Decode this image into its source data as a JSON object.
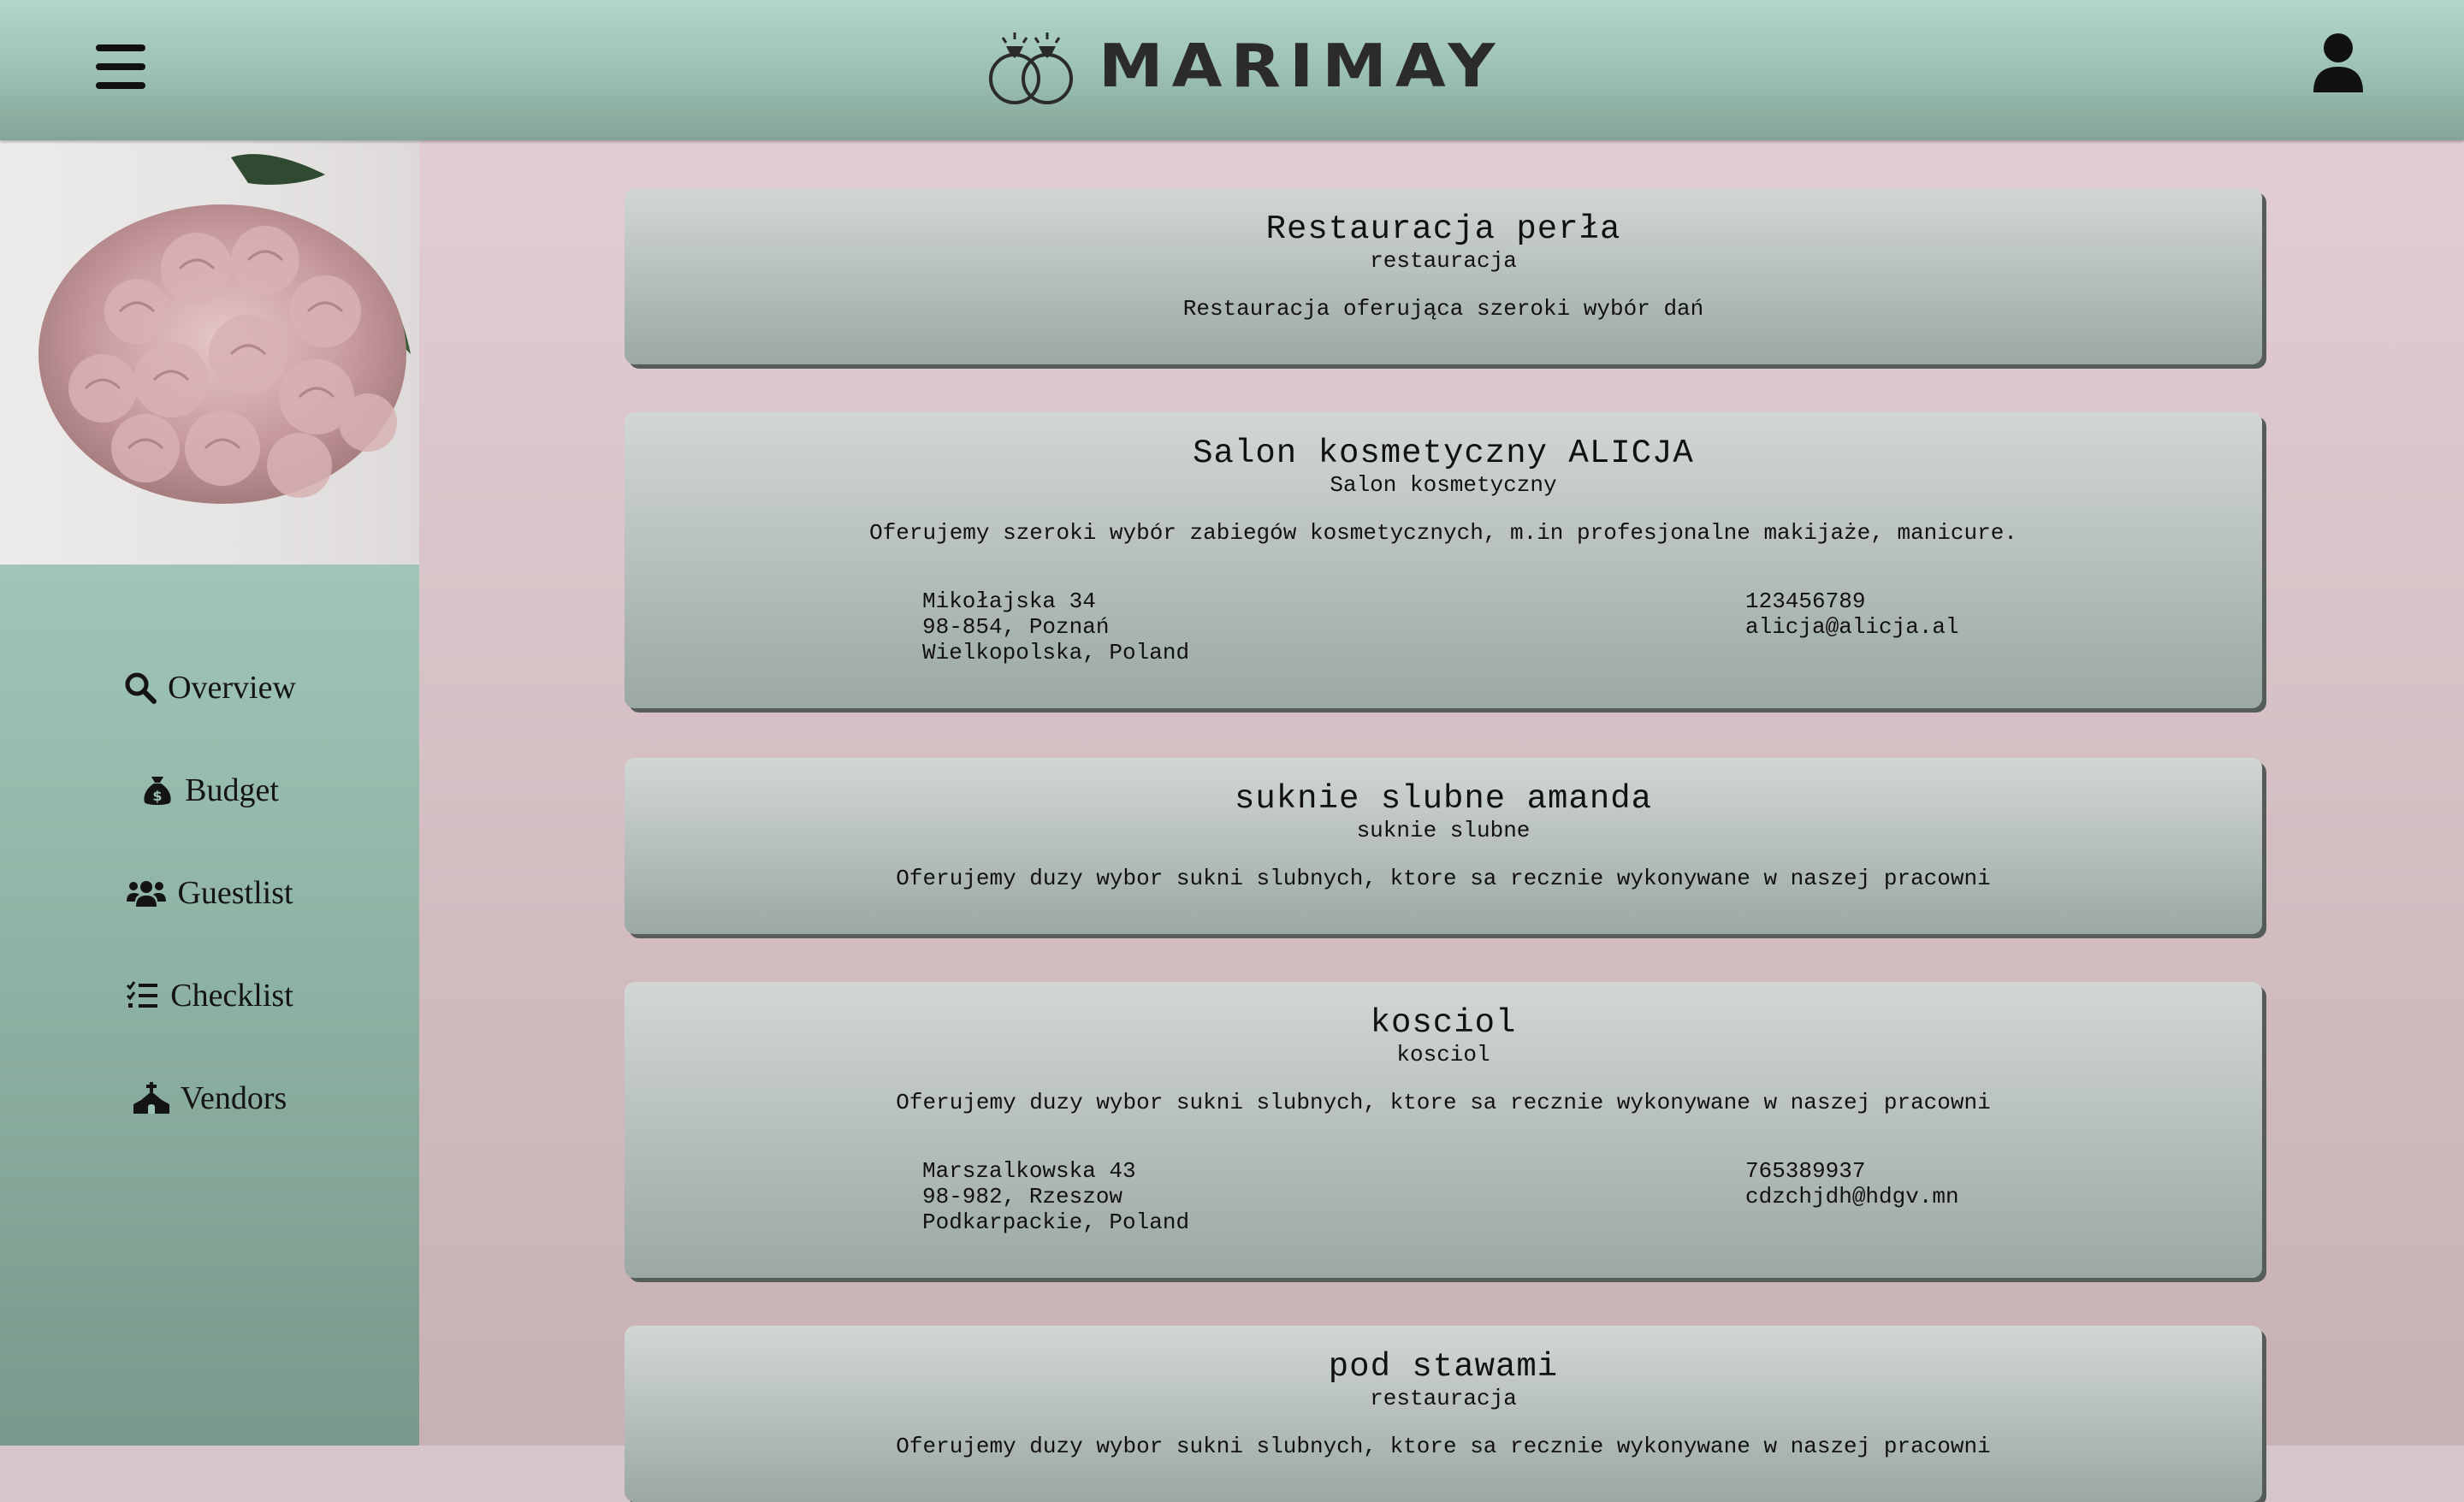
{
  "header": {
    "brand": "MARIMAY",
    "icons": {
      "menu": "hamburger-menu-icon",
      "logo": "wedding-rings-icon",
      "user": "user-icon"
    }
  },
  "sidebar": {
    "photo": "pink hydrangea bouquet",
    "nav": [
      {
        "label": "Overview",
        "icon": "search-icon"
      },
      {
        "label": "Budget",
        "icon": "money-bag-icon"
      },
      {
        "label": "Guestlist",
        "icon": "users-icon"
      },
      {
        "label": "Checklist",
        "icon": "checklist-icon"
      },
      {
        "label": "Vendors",
        "icon": "church-icon"
      }
    ]
  },
  "vendors": [
    {
      "name": "Restauracja perła",
      "category": "restauracja",
      "description": "Restauracja oferująca szeroki wybór dań"
    },
    {
      "name": "Salon kosmetyczny ALICJA",
      "category": "Salon kosmetyczny",
      "description": "Oferujemy szeroki wybór zabiegów kosmetycznych, m.in profesjonalne makijaże, manicure.",
      "street": "Mikołajska 34",
      "city": "98-854, Poznań",
      "region": "Wielkopolska, Poland",
      "phone": "123456789",
      "email": "alicja@alicja.al"
    },
    {
      "name": "suknie slubne amanda",
      "category": "suknie slubne",
      "description": "Oferujemy duzy wybor sukni slubnych, ktore sa recznie wykonywane w naszej pracowni"
    },
    {
      "name": "kosciol",
      "category": "kosciol",
      "description": "Oferujemy duzy wybor sukni slubnych, ktore sa recznie wykonywane w naszej pracowni",
      "street": "Marszalkowska 43",
      "city": "98-982, Rzeszow",
      "region": "Podkarpackie, Poland",
      "phone": "765389937",
      "email": "cdzchjdh@hdgv.mn"
    },
    {
      "name": "pod stawami",
      "category": "restauracja",
      "description": "Oferujemy duzy wybor sukni slubnych, ktore sa recznie wykonywane w naszej pracowni"
    }
  ],
  "colors": {
    "header_top": "#b2d7ca",
    "header_bottom": "#83a597",
    "main_bg": "#e2cdd3",
    "card_top": "#d2d7d4",
    "card_bottom": "#9ba8a4"
  }
}
